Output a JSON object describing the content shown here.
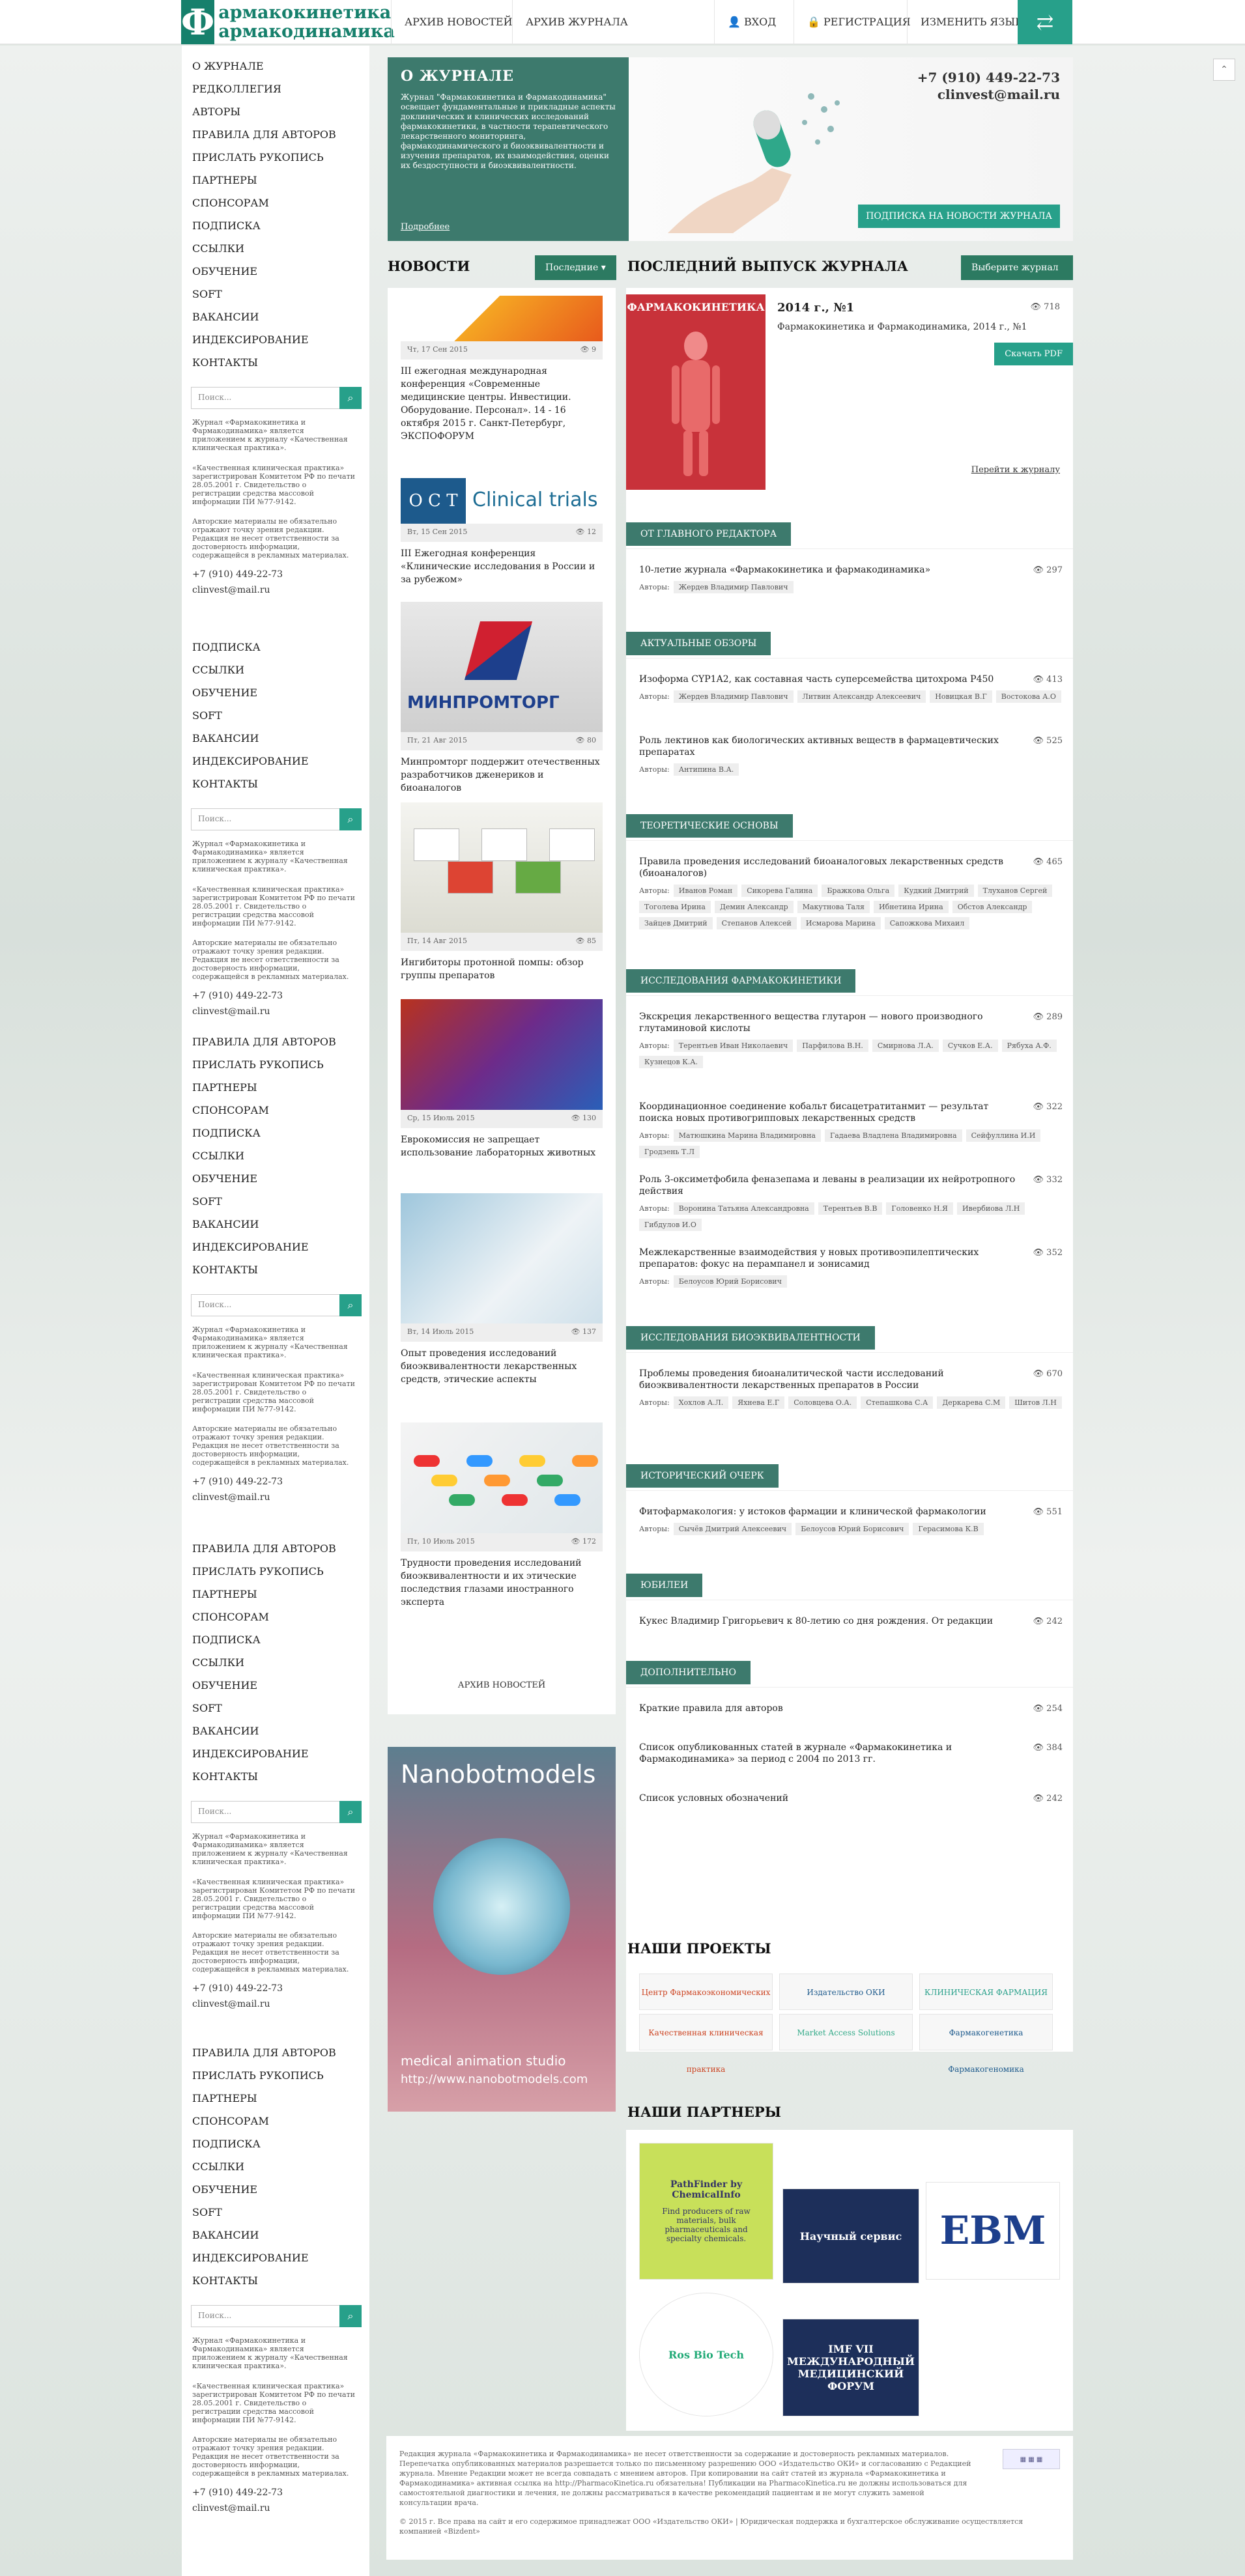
{
  "site": {
    "logo_letter": "Ф",
    "logo_line1": "армакокинетика",
    "logo_line2": "армакодинамика"
  },
  "nav": {
    "archive_news": "АРХИВ НОВОСТЕЙ",
    "archive_journal": "АРХИВ ЖУРНАЛА",
    "login": "ВХОД",
    "register": "РЕГИСТРАЦИЯ",
    "change_lang": "ИЗМЕНИТЬ ЯЗЫК"
  },
  "sidebar": {
    "menu_full": [
      "О ЖУРНАЛЕ",
      "РЕДКОЛЛЕГИЯ",
      "АВТОРЫ",
      "ПРАВИЛА ДЛЯ АВТОРОВ",
      "ПРИСЛАТЬ РУКОПИСЬ",
      "ПАРТНЕРЫ",
      "СПОНСОРАМ",
      "ПОДПИСКА",
      "ССЫЛКИ",
      "ОБУЧЕНИЕ",
      "SOFT",
      "ВАКАНСИИ",
      "ИНДЕКСИРОВАНИЕ",
      "КОНТАКТЫ"
    ],
    "menu_short": [
      "ПОДПИСКА",
      "ССЫЛКИ",
      "ОБУЧЕНИЕ",
      "SOFT",
      "ВАКАНСИИ",
      "ИНДЕКСИРОВАНИЕ",
      "КОНТАКТЫ"
    ],
    "menu_mid": [
      "ПРАВИЛА ДЛЯ АВТОРОВ",
      "ПРИСЛАТЬ РУКОПИСЬ",
      "ПАРТНЕРЫ",
      "СПОНСОРАМ",
      "ПОДПИСКА",
      "ССЫЛКИ",
      "ОБУЧЕНИЕ",
      "SOFT",
      "ВАКАНСИИ",
      "ИНДЕКСИРОВАНИЕ",
      "КОНТАКТЫ"
    ],
    "search_placeholder": "Поиск...",
    "note1": "Журнал «Фармакокинетика и Фармакодинамика» является приложением к журналу «Качественная клиническая практика».",
    "note2": "«Качественная клиническая практика» зарегистрирован Комитетом РФ по печати 28.05.2001 г. Свидетельство о регистрации средства массовой информации ПИ №77-9142.",
    "note3": "Авторские материалы не обязательно отражают точку зрения редакции. Редакция не несет ответственности за достоверность информации, содержащейся в рекламных материалах.",
    "phone": "+7 (910) 449-22-73",
    "email": "clinvest@mail.ru"
  },
  "about": {
    "title": "О ЖУРНАЛЕ",
    "text": "Журнал \"Фармакокинетика и Фармакодинамика\" освещает фундаментальные и прикладные аспекты доклинических и клинических исследований фармакокинетики, в частности терапевтического лекарственного мониторинга, фармакодинамического и биоэквивалентности и изучения препаратов, их взаимодействия, оценки их бездоступности и биоэквивалентности.",
    "more": "Подробнее",
    "phone": "+7 (910) 449-22-73",
    "email": "clinvest@mail.ru",
    "subscribe": "ПОДПИСКА НА НОВОСТИ ЖУРНАЛА"
  },
  "news": {
    "title": "НОВОСТИ",
    "dropdown": "Последние",
    "archive": "АРХИВ НОВОСТЕЙ",
    "items": [
      {
        "date": "Чт, 17 Сен 2015",
        "views": "9",
        "title": "III ежегодная международная конференция «Современные медицинские центры. Инвестиции. Оборудование. Персонал». 14 - 16 октября 2015 г. Санкт-Петербург, ЭКСПОФОРУМ"
      },
      {
        "date": "Вт, 15 Сен 2015",
        "views": "12",
        "title": "III Ежегодная конференция «Клинические исследования в России и за рубежом»"
      },
      {
        "date": "Пт, 21 Авг 2015",
        "views": "80",
        "title": "Минпромторг поддержит отечественных разработчиков дженериков и биоаналогов"
      },
      {
        "date": "Пт, 14 Авг 2015",
        "views": "85",
        "title": "Ингибиторы протонной помпы: обзор группы препаратов"
      },
      {
        "date": "Ср, 15 Июль 2015",
        "views": "130",
        "title": "Еврокомиссия не запрещает использование лабораторных животных"
      },
      {
        "date": "Вт, 14 Июль 2015",
        "views": "137",
        "title": "Опыт проведения исследований биоэквивалентности лекарственных средств, этические аспекты"
      },
      {
        "date": "Пт, 10 Июль 2015",
        "views": "172",
        "title": "Трудности проведения исследований биоэквивалентности и их этические последствия глазами иностранного эксперта"
      }
    ],
    "img1_text": "Clinical trials",
    "img2_text": "МИНПРОМТОРГ",
    "banner_title": "Nanobotmodels",
    "banner_sub": "medical animation studio",
    "banner_url": "http://www.nanobotmodels.com"
  },
  "issue": {
    "title": "ПОСЛЕДНИЙ ВЫПУСК ЖУРНАЛА",
    "dropdown": "Выберите журнал",
    "number": "2014 г., №1",
    "views": "718",
    "subtitle": "Фармакокинетика и Фармакодинамика, 2014 г., №1",
    "download": "Скачать PDF",
    "goto": "Перейти к журналу",
    "cover_title": "ФАРМАКОКИНЕТИКА"
  },
  "sections": [
    {
      "name": "ОТ ГЛАВНОГО РЕДАКТОРА",
      "articles": [
        {
          "title": "10-летие журнала «Фармакокинетика и фармакодинамика»",
          "views": "297",
          "authors": [
            "Жердев Владимир Павлович"
          ]
        }
      ]
    },
    {
      "name": "АКТУАЛЬНЫЕ ОБЗОРЫ",
      "articles": [
        {
          "title": "Изоформа CYP1A2, как составная часть суперсемейства цитохрома P450",
          "views": "413",
          "authors": [
            "Жердев Владимир Павлович",
            "Литвин Александр Алексеевич",
            "Новицкая В.Г",
            "Востокова А.О"
          ]
        },
        {
          "title": "Роль лектинов как биологических активных веществ в фармацевтических препаратах",
          "views": "525",
          "authors": [
            "Антипина В.А."
          ]
        }
      ]
    },
    {
      "name": "ТЕОРЕТИЧЕСКИЕ ОСНОВЫ",
      "articles": [
        {
          "title": "Правила проведения исследований биоаналоговых лекарственных средств (биоаналогов)",
          "views": "465",
          "authors": [
            "Иванов Роман",
            "Сикорева Галина",
            "Бражкова Ольга",
            "Кудкий Дмитрий",
            "Тлуханов Сергей",
            "Тоголева Ирина",
            "Демин Александр",
            "Макутнова Таля",
            "Ибнетина Ирина",
            "Обстов Александр",
            "Зайцев Дмитрий",
            "Степанов Алексей",
            "Исмарова Марина",
            "Сапожкова Михаил"
          ]
        }
      ]
    },
    {
      "name": "ИССЛЕДОВАНИЯ ФАРМАКОКИНЕТИКИ",
      "articles": [
        {
          "title": "Экскреция лекарственного вещества глутарон — нового производного глутаминовой кислоты",
          "views": "289",
          "authors": [
            "Терентьев Иван Николаевич",
            "Парфилова В.Н.",
            "Смирнова Л.А.",
            "Сучков Е.А.",
            "Рябуха А.Ф.",
            "Кузнецов К.А."
          ]
        },
        {
          "title": "Координационное соединение кобальт бисацетратитанмит — результат поиска новых противогрипповых лекарственных средств",
          "views": "322",
          "authors": [
            "Матюшкина Марина Владимировна",
            "Гадаева Владлена Владимировна",
            "Сейфуллина И.И",
            "Гродзень Т.Л"
          ]
        },
        {
          "title": "Роль 3-оксиметфобила феназепама и леваны в реализации их нейротропного действия",
          "views": "332",
          "authors": [
            "Воронина Татьяна Александровна",
            "Терентьев В.В",
            "Головенко Н.Я",
            "Ивербиова Л.Н",
            "Гибдулов И.О"
          ]
        },
        {
          "title": "Межлекарственные взаимодействия у новых противоэпилептических препаратов: фокус на перампанел и зонисамид",
          "views": "352",
          "authors": [
            "Белоусов Юрий Борисович"
          ]
        }
      ]
    },
    {
      "name": "ИССЛЕДОВАНИЯ БИОЭКВИВАЛЕНТНОСТИ",
      "articles": [
        {
          "title": "Проблемы проведения биоаналитической части исследований биоэквивалентности лекарственных препаратов в России",
          "views": "670",
          "authors": [
            "Хохлов А.Л.",
            "Яхнева Е.Г",
            "Соловцева О.А.",
            "Степашкова С.А",
            "Деркарева С.М",
            "Шитов Л.Н"
          ]
        }
      ]
    },
    {
      "name": "ИСТОРИЧЕСКИЙ ОЧЕРК",
      "articles": [
        {
          "title": "Фитофармакология: у истоков фармации и клинической фармакологии",
          "views": "551",
          "authors": [
            "Сычёв Дмитрий Алексеевич",
            "Белоусов Юрий Борисович",
            "Герасимова К.В"
          ]
        }
      ]
    },
    {
      "name": "ЮБИЛЕИ",
      "articles": [
        {
          "title": "Кукес Владимир Григорьевич к 80-летию со дня рождения. От редакции",
          "views": "242",
          "authors": []
        }
      ]
    },
    {
      "name": "ДОПОЛНИТЕЛЬНО",
      "articles": [
        {
          "title": "Краткие правила для авторов",
          "views": "254",
          "authors": []
        },
        {
          "title": "Список опубликованных статей в журнале «Фармакокинетика и Фармакодинамика» за период с 2004 по 2013 гг.",
          "views": "384",
          "authors": []
        },
        {
          "title": "Список условных обозначений",
          "views": "242",
          "authors": []
        }
      ]
    }
  ],
  "projects": {
    "title": "НАШИ ПРОЕКТЫ",
    "items": [
      "Центр Фармакоэкономических Исследований",
      "Издательство ОКИ",
      "КЛИНИЧЕСКАЯ ФАРМАЦИЯ",
      "Качественная клиническая практика",
      "Market Access Solutions",
      "Фармакогенетика Фармакогеномика"
    ]
  },
  "partners": {
    "title": "НАШИ ПАРТНЕРЫ",
    "items": [
      "PathFinder by ChemicalInfo",
      "Научный сервис",
      "EBM",
      "Ros Bio Tech",
      "IMF VII МЕЖДУНАРОДНЫЙ МЕДИЦИНСКИЙ ФОРУМ"
    ],
    "pathfinder_text": "Find producers of raw materials, bulk pharmaceuticals and specialty chemicals."
  },
  "footer": {
    "text": "Редакция журнала «Фармакокинетика и Фармакодинамика» не несет ответственности за содержание и достоверность рекламных материалов. Перепечатка опубликованных материалов разрешается только по письменному разрешению ООО «Издательство ОКИ» и согласованию с Редакцией журнала. Мнение Редакции может не всегда совпадать с мнением авторов. При копировании на сайт статей из журнала «Фармакокинетика и Фармакодинамика» активная ссылка на http://PharmacoKinetica.ru обязательна! Публикации на PharmacoKinetica.ru не должны использоваться для самостоятельной диагностики и лечения, не должны рассматриваться в качестве рекомендаций пациентам и не могут служить заменой консультации врача.",
    "copyright": "© 2015 г. Все права на сайт и его содержимое принадлежат ООО «Издательство ОКИ» | Юридическая поддержка и бухгалтерское обслуживание осуществляется компанией «Bizdent»"
  },
  "colors": {
    "brand": "#16806c",
    "accent": "#27a08a",
    "panel": "#3d7a6d"
  }
}
